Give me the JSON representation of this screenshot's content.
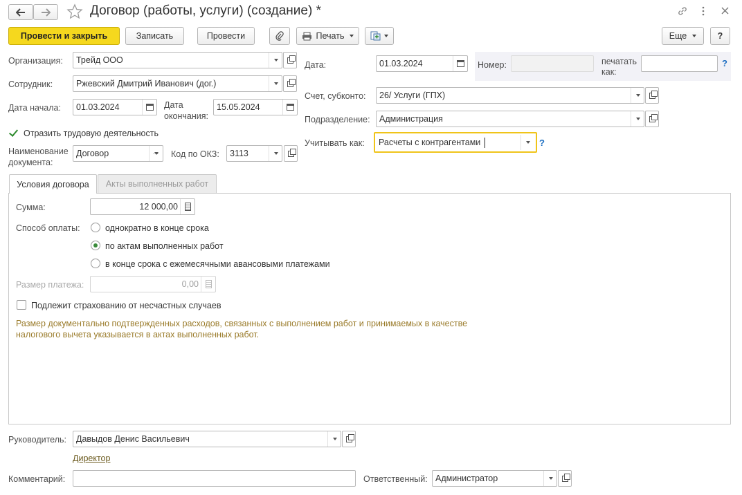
{
  "window": {
    "title": "Договор (работы, услуги) (создание) *",
    "back_icon": "arrow-left-icon",
    "forward_icon": "arrow-right-icon",
    "favorite_icon": "star-icon",
    "link_icon": "link-icon",
    "more_icon": "more-vertical-icon",
    "close_icon": "close-icon"
  },
  "toolbar": {
    "post_and_close": "Провести и закрыть",
    "save": "Записать",
    "post": "Провести",
    "print": "Печать",
    "more": "Еще",
    "help": "?"
  },
  "header_left": {
    "organization_label": "Организация:",
    "organization_value": "Трейд ООО",
    "employee_label": "Сотрудник:",
    "employee_value": "Ржевский Дмитрий Иванович (дог.)",
    "start_date_label": "Дата начала:",
    "start_date_value": "01.03.2024",
    "end_date_label_1": "Дата",
    "end_date_label_2": "окончания:",
    "end_date_value": "15.05.2024",
    "reflect_work_label": "Отразить трудовую деятельность",
    "doc_name_label_1": "Наименование",
    "doc_name_label_2": "документа:",
    "doc_name_value": "Договор",
    "doc_name_select": "...",
    "okz_label": "Код по ОКЗ:",
    "okz_value": "3113"
  },
  "header_right": {
    "date_label": "Дата:",
    "date_value": "01.03.2024",
    "number_label": "Номер:",
    "number_value": "",
    "print_as_label_1": "печатать",
    "print_as_label_2": "как:",
    "print_as_value": "",
    "help": "?",
    "account_label": "Счет, субконто:",
    "account_value": "26/ Услуги (ГПХ)",
    "department_label": "Подразделение:",
    "department_value": "Администрация",
    "account_as_label": "Учитывать как:",
    "account_as_value": "Расчеты с контрагентами",
    "account_as_help": "?"
  },
  "tabs": [
    {
      "label": "Условия договора",
      "active": true
    },
    {
      "label": "Акты выполненных работ",
      "active": false
    }
  ],
  "conditions": {
    "sum_label": "Сумма:",
    "sum_value": "12 000,00",
    "payment_method_label": "Способ оплаты:",
    "payment_options": [
      {
        "label": "однократно в конце срока",
        "selected": false
      },
      {
        "label": "по актам выполненных работ",
        "selected": true
      },
      {
        "label": "в конце срока с ежемесячными авансовыми платежами",
        "selected": false
      }
    ],
    "payment_size_label": "Размер платежа:",
    "payment_size_value": "0,00",
    "insurance_label": "Подлежит страхованию от несчастных случаев",
    "note_line_1": "Размер документально подтвержденных расходов, связанных с выполнением работ и принимаемых в качестве",
    "note_line_2": "налогового вычета указывается в актах выполненных работ."
  },
  "footer": {
    "head_label": "Руководитель:",
    "head_value": "Давыдов Денис Васильевич",
    "head_position": "Директор",
    "comment_label": "Комментарий:",
    "comment_value": "",
    "responsible_label": "Ответственный:",
    "responsible_value": "Администратор"
  },
  "colors": {
    "primary_button": "#f5d81e",
    "focus_border": "#f0c419",
    "help": "#1e6fc2",
    "note_text": "#9a7b2a"
  }
}
